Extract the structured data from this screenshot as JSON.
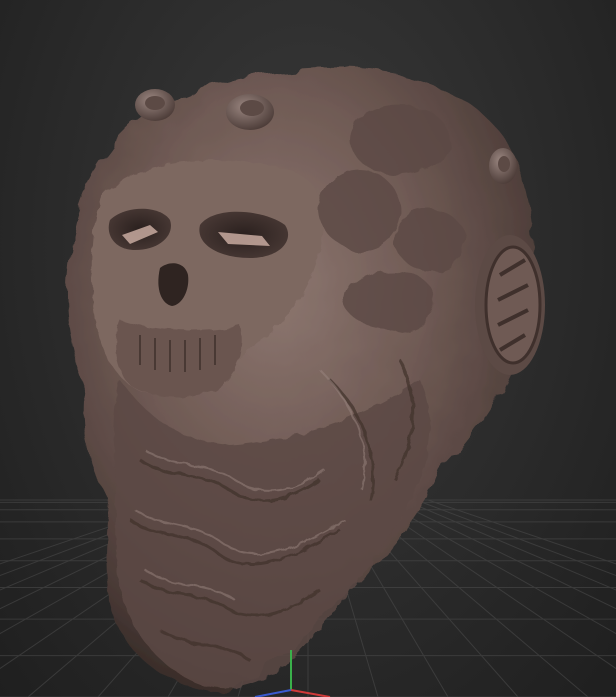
{
  "viewport": {
    "background_top": "#3a3a3a",
    "background_bottom": "#1f1f1f",
    "grid_color": "#4a4a4a",
    "model_color": "#6f5a54",
    "model_shadow": "#3f302c",
    "model_highlight": "#9a8680"
  },
  "gizmo": {
    "x_color": "#d03a3a",
    "y_color": "#3ab04a",
    "z_color": "#3a5ad0"
  }
}
